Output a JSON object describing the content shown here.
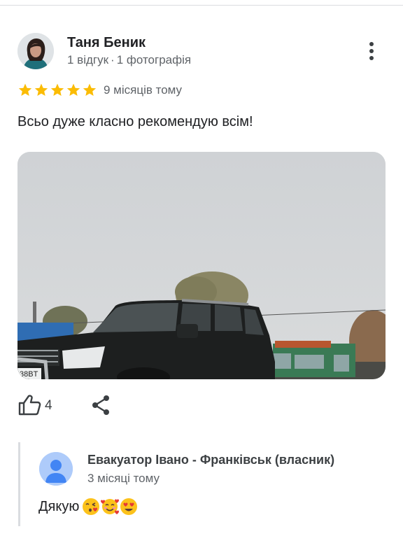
{
  "review": {
    "author": {
      "name": "Таня Беник",
      "reviews_count": "1 відгук",
      "separator": "·",
      "photos_count": "1 фотографія"
    },
    "rating": 5,
    "rating_color": "#fbbc04",
    "time_ago": "9 місяців тому",
    "text": "Всьо дуже класно рекомендую всім!",
    "photo": {
      "icon": "review-photo",
      "license_plate_fragment": "38BT"
    },
    "actions": {
      "like_icon": "thumb-up-icon",
      "like_count": "4",
      "share_icon": "share-icon",
      "more_icon": "more-vertical-icon"
    }
  },
  "owner_reply": {
    "author": "Евакуатор Івано - Франківськ (власник)",
    "time_ago": "3 місяці тому",
    "text": "Дякую",
    "emojis": [
      "face-blowing-kiss",
      "smiling-face-with-hearts",
      "smiling-face-with-heart-eyes"
    ],
    "avatar_color": "#aecbfa"
  }
}
